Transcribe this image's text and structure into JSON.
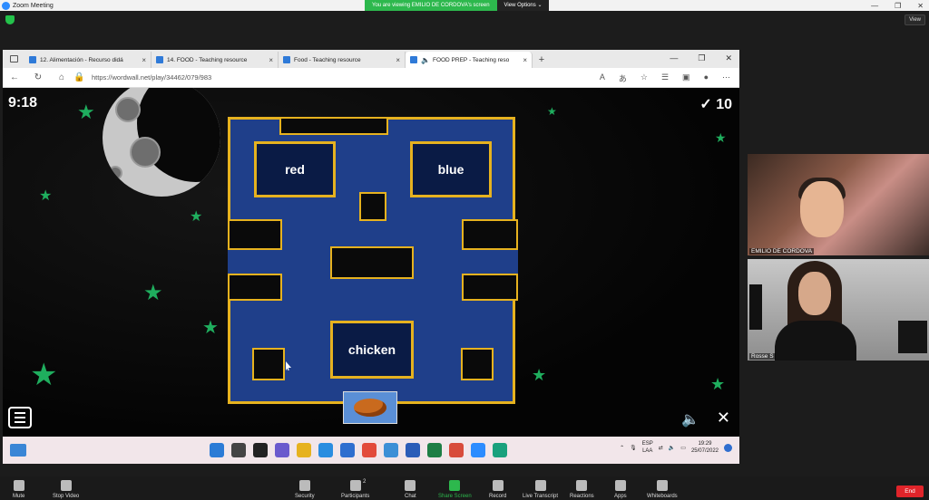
{
  "zoom": {
    "title": "Zoom Meeting",
    "viewing_banner": "You are viewing EMILIO DE CORDOVA's screen",
    "view_options": "View Options ⌄",
    "view_button": "View",
    "win_minimize": "—",
    "win_maximize": "❐",
    "win_close": "✕"
  },
  "browser": {
    "tabs": [
      {
        "title": "12. Alimentación - Recurso didá",
        "close": "×"
      },
      {
        "title": "14. FOOD - Teaching resource",
        "close": "×"
      },
      {
        "title": "Food - Teaching resource",
        "close": "×"
      },
      {
        "title": "FOOD PREP - Teaching reso",
        "close": "×"
      }
    ],
    "new_tab": "+",
    "url": "https://wordwall.net/play/34462/079/983",
    "ctrl_min": "—",
    "ctrl_max": "❐",
    "ctrl_close": "✕"
  },
  "game": {
    "timer": "9:18",
    "score": "✓ 10",
    "cards": [
      "red",
      "blue",
      "chicken"
    ],
    "volume_icon": "🔈",
    "close_icon": "✕"
  },
  "taskbar": {
    "lang_line1": "ESP",
    "lang_line2": "LAA",
    "time": "19:29",
    "date": "25/07/2022"
  },
  "participants": [
    {
      "name": "EMILIO DE CORDOVA"
    },
    {
      "name": "Rosse S"
    }
  ],
  "toolbar": {
    "mute": "Mute",
    "stop_video": "Stop Video",
    "security": "Security",
    "participants": "Participants",
    "participants_count": "2",
    "chat": "Chat",
    "share_screen": "Share Screen",
    "record": "Record",
    "live_transcript": "Live Transcript",
    "reactions": "Reactions",
    "apps": "Apps",
    "whiteboards": "Whiteboards",
    "end": "End"
  }
}
